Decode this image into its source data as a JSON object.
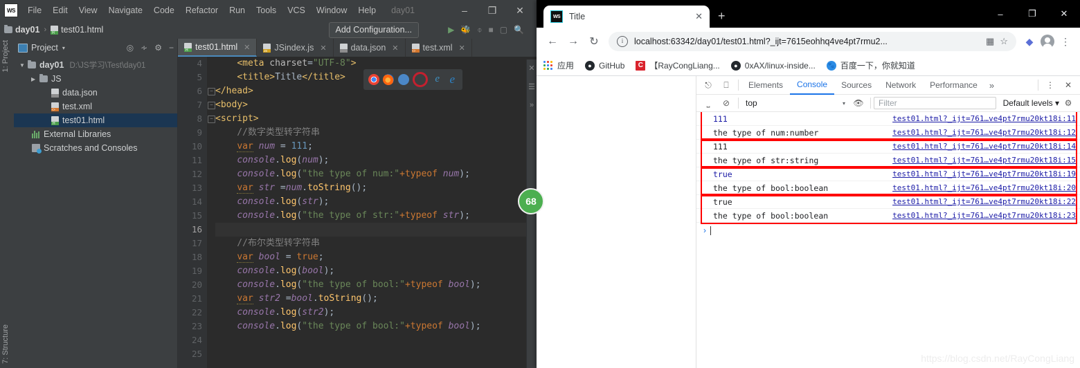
{
  "ide": {
    "app_badge": "WS",
    "menu": [
      "File",
      "Edit",
      "View",
      "Navigate",
      "Code",
      "Refactor",
      "Run",
      "Tools",
      "VCS",
      "Window",
      "Help"
    ],
    "project_name": "day01",
    "window_controls": {
      "minimize": "–",
      "maximize": "❐",
      "close": "✕"
    },
    "navbar": {
      "crumb_project": "day01",
      "crumb_sep": "›",
      "crumb_file": "test01.html",
      "add_configuration": "Add Configuration...",
      "run_icon": "run-icon",
      "debug_icon": "debug-icon",
      "coverage_icon": "coverage-icon",
      "stop_icon": "stop-icon",
      "terminal_icon": "terminal-icon",
      "search_icon": "search-icon",
      "menu_icon": "hamburger-icon"
    },
    "tool_windows": {
      "left": "1: Project",
      "bottom_left": "7: Structure",
      "right_more": "»",
      "right_close": "✕"
    },
    "project_panel": {
      "title": "Project",
      "caret": "▾",
      "actions": [
        "locate-icon",
        "collapse-all-icon",
        "settings-icon",
        "hide-icon"
      ],
      "tree": [
        {
          "name": "day01",
          "path": "D:\\JS学习\\Test\\day01",
          "icon": "folder-icon",
          "arrow": "▼",
          "depth": 0,
          "bold": true,
          "selected": false
        },
        {
          "name": "JS",
          "path": "",
          "icon": "folder-icon",
          "arrow": "▶",
          "depth": 1,
          "bold": false,
          "selected": false
        },
        {
          "name": "data.json",
          "path": "",
          "icon": "json-file-icon",
          "arrow": "",
          "depth": 2,
          "bold": false,
          "selected": false
        },
        {
          "name": "test.xml",
          "path": "",
          "icon": "xml-file-icon",
          "arrow": "",
          "depth": 2,
          "bold": false,
          "selected": false
        },
        {
          "name": "test01.html",
          "path": "",
          "icon": "html-file-icon",
          "arrow": "",
          "depth": 2,
          "bold": false,
          "selected": true
        },
        {
          "name": "External Libraries",
          "path": "",
          "icon": "library-icon",
          "arrow": "",
          "depth": 1,
          "bold": false,
          "selected": false
        },
        {
          "name": "Scratches and Consoles",
          "path": "",
          "icon": "scratches-icon",
          "arrow": "",
          "depth": 1,
          "bold": false,
          "selected": false
        }
      ]
    },
    "editor_tabs": [
      {
        "label": "test01.html",
        "icon": "html-file-icon",
        "active": true
      },
      {
        "label": "JSindex.js",
        "icon": "js-file-icon",
        "active": false
      },
      {
        "label": "data.json",
        "icon": "json-file-icon",
        "active": false
      },
      {
        "label": "test.xml",
        "icon": "xml-file-icon",
        "active": false
      }
    ],
    "browser_popup": {
      "browsers": [
        "chrome-icon",
        "firefox-icon",
        "safari-icon",
        "opera-icon",
        "explorer-icon",
        "edge-icon"
      ]
    },
    "inspection_badge": "68",
    "editor": {
      "first_line": 4,
      "current_line": 16,
      "line_numbers": [
        4,
        5,
        6,
        7,
        8,
        9,
        10,
        11,
        12,
        13,
        14,
        15,
        16,
        17,
        18,
        19,
        20,
        21,
        22,
        23,
        24,
        25
      ],
      "lines": [
        {
          "n": 4,
          "text": "    <meta charset=\"UTF-8\">"
        },
        {
          "n": 5,
          "text": "    <title>Title</title>"
        },
        {
          "n": 6,
          "text": "</head>"
        },
        {
          "n": 7,
          "text": "<body>"
        },
        {
          "n": 8,
          "text": "<script>"
        },
        {
          "n": 9,
          "text": "    //数字类型转字符串"
        },
        {
          "n": 10,
          "text": "    var num = 111;"
        },
        {
          "n": 11,
          "text": "    console.log(num);"
        },
        {
          "n": 12,
          "text": "    console.log(\"the type of num:\"+typeof num);"
        },
        {
          "n": 13,
          "text": "    var str =num.toString();"
        },
        {
          "n": 14,
          "text": "    console.log(str);"
        },
        {
          "n": 15,
          "text": "    console.log(\"the type of str:\"+typeof str);"
        },
        {
          "n": 16,
          "text": ""
        },
        {
          "n": 17,
          "text": "    //布尔类型转字符串"
        },
        {
          "n": 18,
          "text": "    var bool = true;"
        },
        {
          "n": 19,
          "text": "    console.log(bool);"
        },
        {
          "n": 20,
          "text": "    console.log(\"the type of bool:\"+typeof bool);"
        },
        {
          "n": 21,
          "text": "    var str2 =bool.toString();"
        },
        {
          "n": 22,
          "text": "    console.log(str2);"
        },
        {
          "n": 23,
          "text": "    console.log(\"the type of bool:\"+typeof bool);"
        },
        {
          "n": 24,
          "text": ""
        },
        {
          "n": 25,
          "text": ""
        }
      ]
    }
  },
  "chrome": {
    "tab": {
      "title": "Title",
      "favicon": "webstorm-favicon",
      "close": "✕"
    },
    "new_tab": "+",
    "window_controls": {
      "minimize": "–",
      "maximize": "❐",
      "close": "✕"
    },
    "toolbar": {
      "back": "←",
      "forward": "→",
      "reload": "↻",
      "info_icon": "ⓘ",
      "url": "localhost:63342/day01/test01.html?_ijt=7615eohhq4ve4pt7rmu2...",
      "url_host": "localhost",
      "url_rest": ":63342/day01/test01.html?_ijt=7615eohhq4ve4pt7rmu2...",
      "translate_icon": "translate-icon",
      "star_icon": "☆",
      "extension_icon": "extension-icon",
      "profile_icon": "avatar-icon",
      "menu_icon": "⋮"
    },
    "bookmarks": [
      {
        "label": "应用",
        "icon": "apps-grid-icon"
      },
      {
        "label": "GitHub",
        "icon": "github-icon"
      },
      {
        "label": "【RayCongLiang...",
        "icon": "csdn-icon"
      },
      {
        "label": "0xAX/linux-inside...",
        "icon": "github-icon"
      },
      {
        "label": "百度一下，你就知道",
        "icon": "baidu-icon"
      }
    ]
  },
  "devtools": {
    "inspect_icon": "inspect-element-icon",
    "device_icon": "toggle-device-toolbar-icon",
    "tabs": [
      {
        "label": "Elements",
        "active": false
      },
      {
        "label": "Console",
        "active": true
      },
      {
        "label": "Sources",
        "active": false
      },
      {
        "label": "Network",
        "active": false
      },
      {
        "label": "Performance",
        "active": false
      }
    ],
    "more_tabs": "»",
    "kebab": "⋮",
    "close": "✕",
    "filterbar": {
      "sidebar_icon": "console-sidebar-icon",
      "clear_icon": "clear-console-icon",
      "context": "top",
      "context_caret": "▾",
      "eye_icon": "live-expression-icon",
      "filter_placeholder": "Filter",
      "levels": "Default levels",
      "levels_caret": "▾",
      "settings_icon": "settings-gear-icon"
    },
    "console_rows": [
      {
        "message": "111",
        "type": "number",
        "source": "test01.html?_ijt=761…ve4pt7rmu20kt18i:11"
      },
      {
        "message": "the type of num:number",
        "type": "string",
        "source": "test01.html?_ijt=761…ve4pt7rmu20kt18i:12"
      },
      {
        "message": "111",
        "type": "string",
        "source": "test01.html?_ijt=761…ve4pt7rmu20kt18i:14"
      },
      {
        "message": "the type of str:string",
        "type": "string",
        "source": "test01.html?_ijt=761…ve4pt7rmu20kt18i:15"
      },
      {
        "message": "true",
        "type": "boolean",
        "source": "test01.html?_ijt=761…ve4pt7rmu20kt18i:19"
      },
      {
        "message": "the type of bool:boolean",
        "type": "string",
        "source": "test01.html?_ijt=761…ve4pt7rmu20kt18i:20"
      },
      {
        "message": "true",
        "type": "string",
        "source": "test01.html?_ijt=761…ve4pt7rmu20kt18i:22"
      },
      {
        "message": "the type of bool:boolean",
        "type": "string",
        "source": "test01.html?_ijt=761…ve4pt7rmu20kt18i:23"
      }
    ],
    "prompt": "›",
    "annotation_color": "#ff0000",
    "highlight_groups": [
      [
        0,
        1
      ],
      [
        2,
        3
      ],
      [
        4,
        5
      ],
      [
        6,
        7
      ]
    ]
  },
  "watermark": "https://blog.csdn.net/RayCongLiang"
}
